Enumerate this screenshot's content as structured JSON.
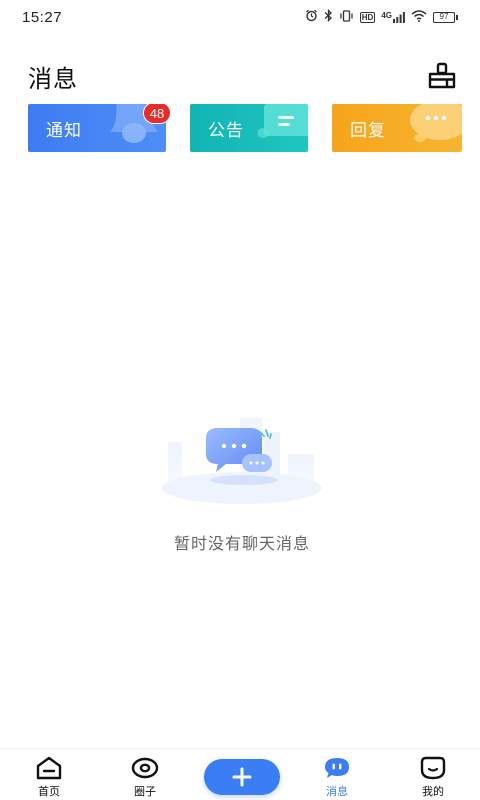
{
  "status_bar": {
    "time": "15:27",
    "battery": "97",
    "network": "4G",
    "hd": "HD"
  },
  "header": {
    "title": "消息",
    "clean_icon": "broom-icon"
  },
  "categories": [
    {
      "label": "通知",
      "badge": "48",
      "icon": "bell-icon",
      "color": "#3d7cf2"
    },
    {
      "label": "公告",
      "icon": "document-icon",
      "color": "#13b4b4"
    },
    {
      "label": "回复",
      "icon": "chat-bubble-icon",
      "color": "#f6a51a"
    }
  ],
  "empty_state": {
    "text": "暂时没有聊天消息",
    "icon": "empty-chat-illustration"
  },
  "bottom_nav": {
    "items": [
      {
        "label": "首页",
        "icon": "home-icon"
      },
      {
        "label": "圈子",
        "icon": "eye-icon"
      },
      {
        "label": "消息",
        "icon": "message-icon",
        "active": true
      },
      {
        "label": "我的",
        "icon": "face-icon"
      }
    ],
    "add_icon": "plus-icon"
  },
  "colors": {
    "accent": "#3b7df3",
    "badge": "#e82c2c",
    "text_muted": "#666666"
  }
}
